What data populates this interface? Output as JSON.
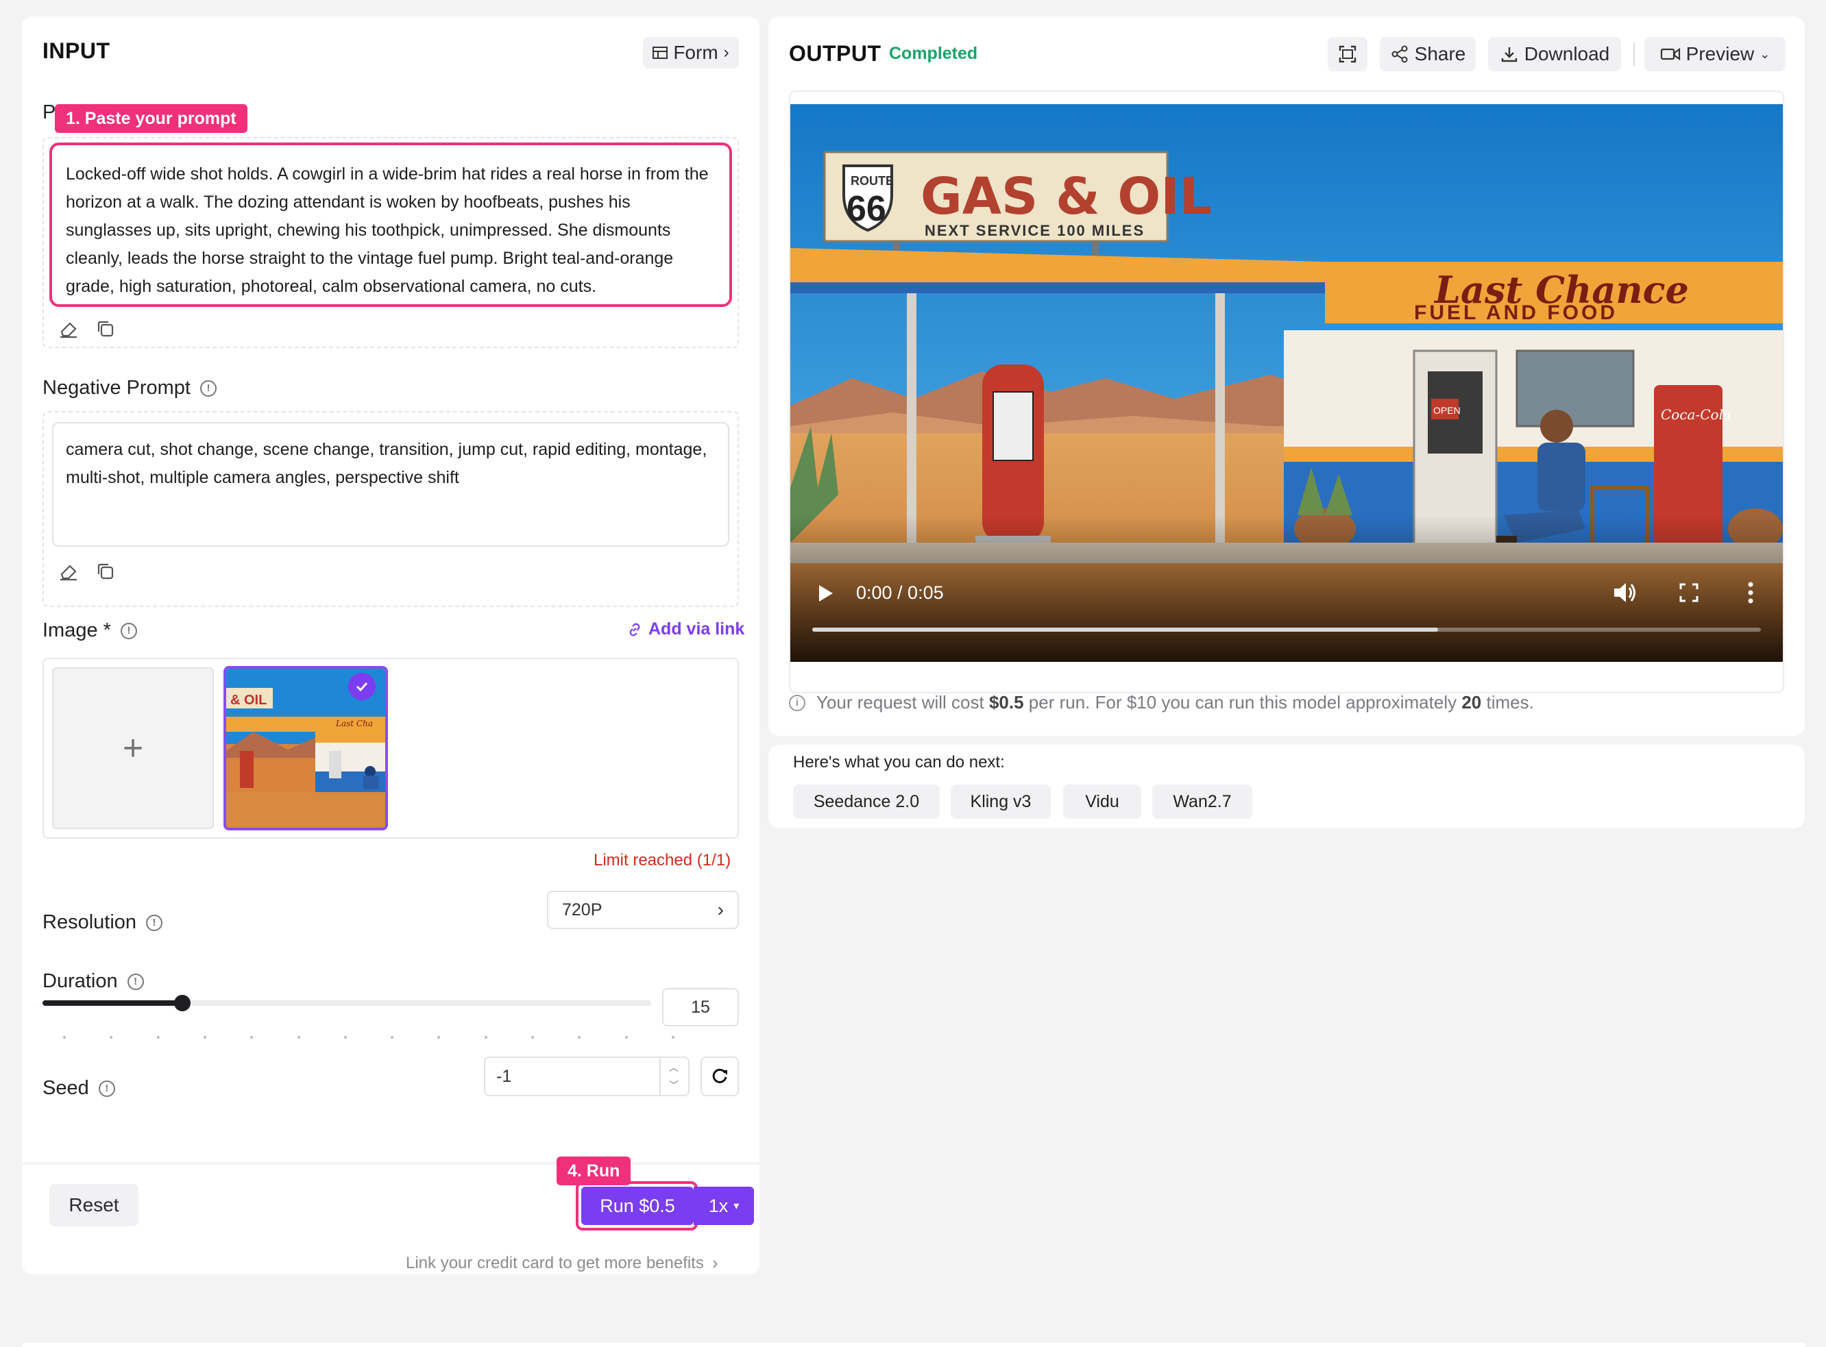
{
  "input": {
    "title": "INPUT",
    "form_label": "Form",
    "prompt": {
      "label_partial": "P",
      "tag": "1. Paste your prompt",
      "value": "Locked-off wide shot holds. A cowgirl in a wide-brim hat rides a real horse in from the horizon at a walk. The dozing attendant is woken by hoofbeats, pushes his sunglasses up, sits upright, chewing his toothpick, unimpressed. She dismounts cleanly, leads the horse straight to the vintage fuel pump. Bright teal-and-orange grade, high saturation, photoreal, calm observational camera, no cuts."
    },
    "negative_prompt": {
      "label": "Negative Prompt",
      "value": "camera cut, shot change, scene change, transition, jump cut, rapid editing, montage, multi-shot, multiple camera angles, perspective shift"
    },
    "image": {
      "label": "Image *",
      "add_link": "Add via link",
      "add_symbol": "+",
      "limit_text": "Limit reached (1/1)"
    },
    "resolution": {
      "label": "Resolution",
      "value": "720P"
    },
    "duration": {
      "label": "Duration",
      "value": "15",
      "level_fraction": 0.23
    },
    "seed": {
      "label": "Seed",
      "value": "-1"
    },
    "footer": {
      "reset": "Reset",
      "run_tag": "4. Run",
      "run_label": "Run $0.5",
      "multiplier": "1x",
      "credit_hint": "Link your credit card to get more benefits"
    }
  },
  "output": {
    "title": "OUTPUT",
    "status": "Completed",
    "share": "Share",
    "download": "Download",
    "preview": "Preview",
    "video": {
      "time": "0:00 / 0:05",
      "progress_fraction": 0.66,
      "sign_route": "ROUTE",
      "sign_66": "66",
      "sign_main": "GAS & OIL",
      "sign_sub": "NEXT SERVICE 100 MILES",
      "canopy_script": "Last Chance",
      "canopy_sub": "FUEL AND FOOD",
      "door_sign": "OPEN",
      "cola": "Coca-Cola"
    },
    "cost": {
      "p1": "Your request will cost ",
      "amount": "$0.5",
      "p2": " per run. For $10 you can run this model approximately ",
      "count": "20",
      "p3": " times."
    }
  },
  "next": {
    "title": "Here's what you can do next:",
    "items": [
      "Seedance 2.0",
      "Kling v3",
      "Vidu",
      "Wan2.7"
    ]
  },
  "colors": {
    "accent_purple": "#7b3df0",
    "highlight_pink": "#f0307a",
    "status_green": "#1aa36b",
    "limit_red": "#d22a1f"
  }
}
